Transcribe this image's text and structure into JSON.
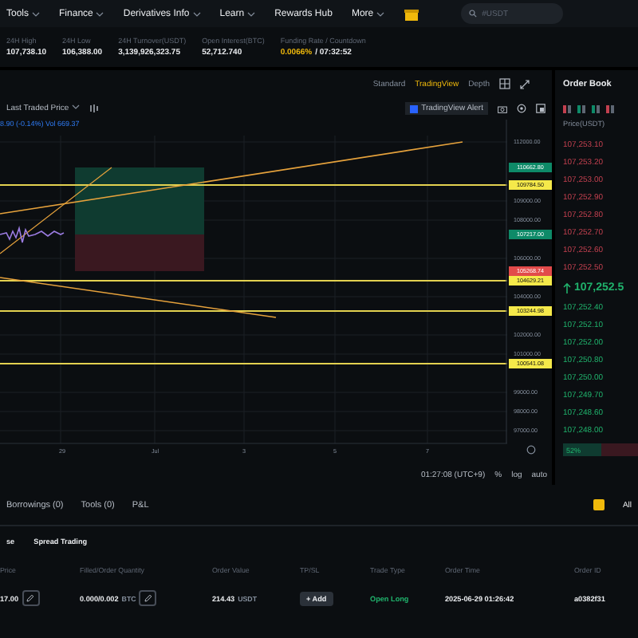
{
  "nav": {
    "items": [
      {
        "label": "Tools",
        "caret": true
      },
      {
        "label": "Finance",
        "caret": true
      },
      {
        "label": "Derivatives Info",
        "caret": true
      },
      {
        "label": "Learn",
        "caret": true
      },
      {
        "label": "Rewards Hub",
        "caret": false
      },
      {
        "label": "More",
        "caret": true
      }
    ],
    "search": {
      "placeholder": "#USDT"
    }
  },
  "stats": [
    {
      "label": "24H High",
      "value": "107,738.10"
    },
    {
      "label": "24H Low",
      "value": "106,388.00"
    },
    {
      "label": "24H Turnover(USDT)",
      "value": "3,139,926,323.75"
    },
    {
      "label": "Open Interest(BTC)",
      "value": "52,712.740"
    }
  ],
  "funding": {
    "label": "Funding Rate / Countdown",
    "rate": "0.0066%",
    "countdown": "/ 07:32:52"
  },
  "chart": {
    "views": [
      {
        "label": "Standard",
        "selected": false
      },
      {
        "label": "TradingView",
        "selected": true
      },
      {
        "label": "Depth",
        "selected": false
      }
    ],
    "price_type": "Last Traded Price",
    "alert": "TradingView Alert",
    "legend": "8.90 (-0.14%)",
    "volume": "Vol 669.37",
    "ticks": [
      "112000.00",
      "109000.00",
      "108000.00",
      "106000.00",
      "104000.00",
      "102000.00",
      "101000.00",
      "99000.00",
      "98000.00",
      "97000.00"
    ],
    "tags": [
      {
        "label": "110662.80",
        "kind": "green"
      },
      {
        "label": "109784.50",
        "kind": "yellow"
      },
      {
        "label": "107217.00",
        "kind": "green"
      },
      {
        "label": "105268.74",
        "kind": "red"
      },
      {
        "label": "104629.21",
        "kind": "yellow"
      },
      {
        "label": "103244.98",
        "kind": "yellow"
      },
      {
        "label": "100541.08",
        "kind": "yellow"
      }
    ],
    "x_labels": [
      "29",
      "Jul",
      "3",
      "5",
      "7"
    ],
    "footer": {
      "time": "01:27:08 (UTC+9)",
      "options": [
        "%",
        "log",
        "auto"
      ]
    }
  },
  "order_book": {
    "title": "Order Book",
    "column": "Price(USDT)",
    "asks": [
      "107,253.10",
      "107,253.20",
      "107,253.00",
      "107,252.90",
      "107,252.80",
      "107,252.70",
      "107,252.60",
      "107,252.50"
    ],
    "last": "107,252.5",
    "bids": [
      "107,252.40",
      "107,252.10",
      "107,252.00",
      "107,250.80",
      "107,250.00",
      "107,249.70",
      "107,248.60",
      "107,248.00"
    ],
    "buy_ratio": "52%",
    "level": 0.52
  },
  "orders": {
    "tabs": [
      {
        "label": "Borrowings (0)",
        "selected": false
      },
      {
        "label": "Tools (0)",
        "selected": false
      },
      {
        "label": "P&L",
        "selected": false
      }
    ],
    "all": {
      "label": "All",
      "checked": true
    },
    "subtabs": [
      {
        "label": "se"
      },
      {
        "label": "Spread Trading"
      }
    ],
    "columns": [
      "Price",
      "Filled/Order Quantity",
      "Order Value",
      "TP/SL",
      "Trade Type",
      "Order Time",
      "Order ID"
    ],
    "row": {
      "price": "17.00",
      "quantity": "0.000/0.002",
      "quantity_unit": "BTC",
      "value": "214.43",
      "value_unit": "USDT",
      "tpsl": "+ Add",
      "trade_type": "Open Long",
      "time": "2025-06-29 01:26:42",
      "id": "a0382f31"
    }
  }
}
